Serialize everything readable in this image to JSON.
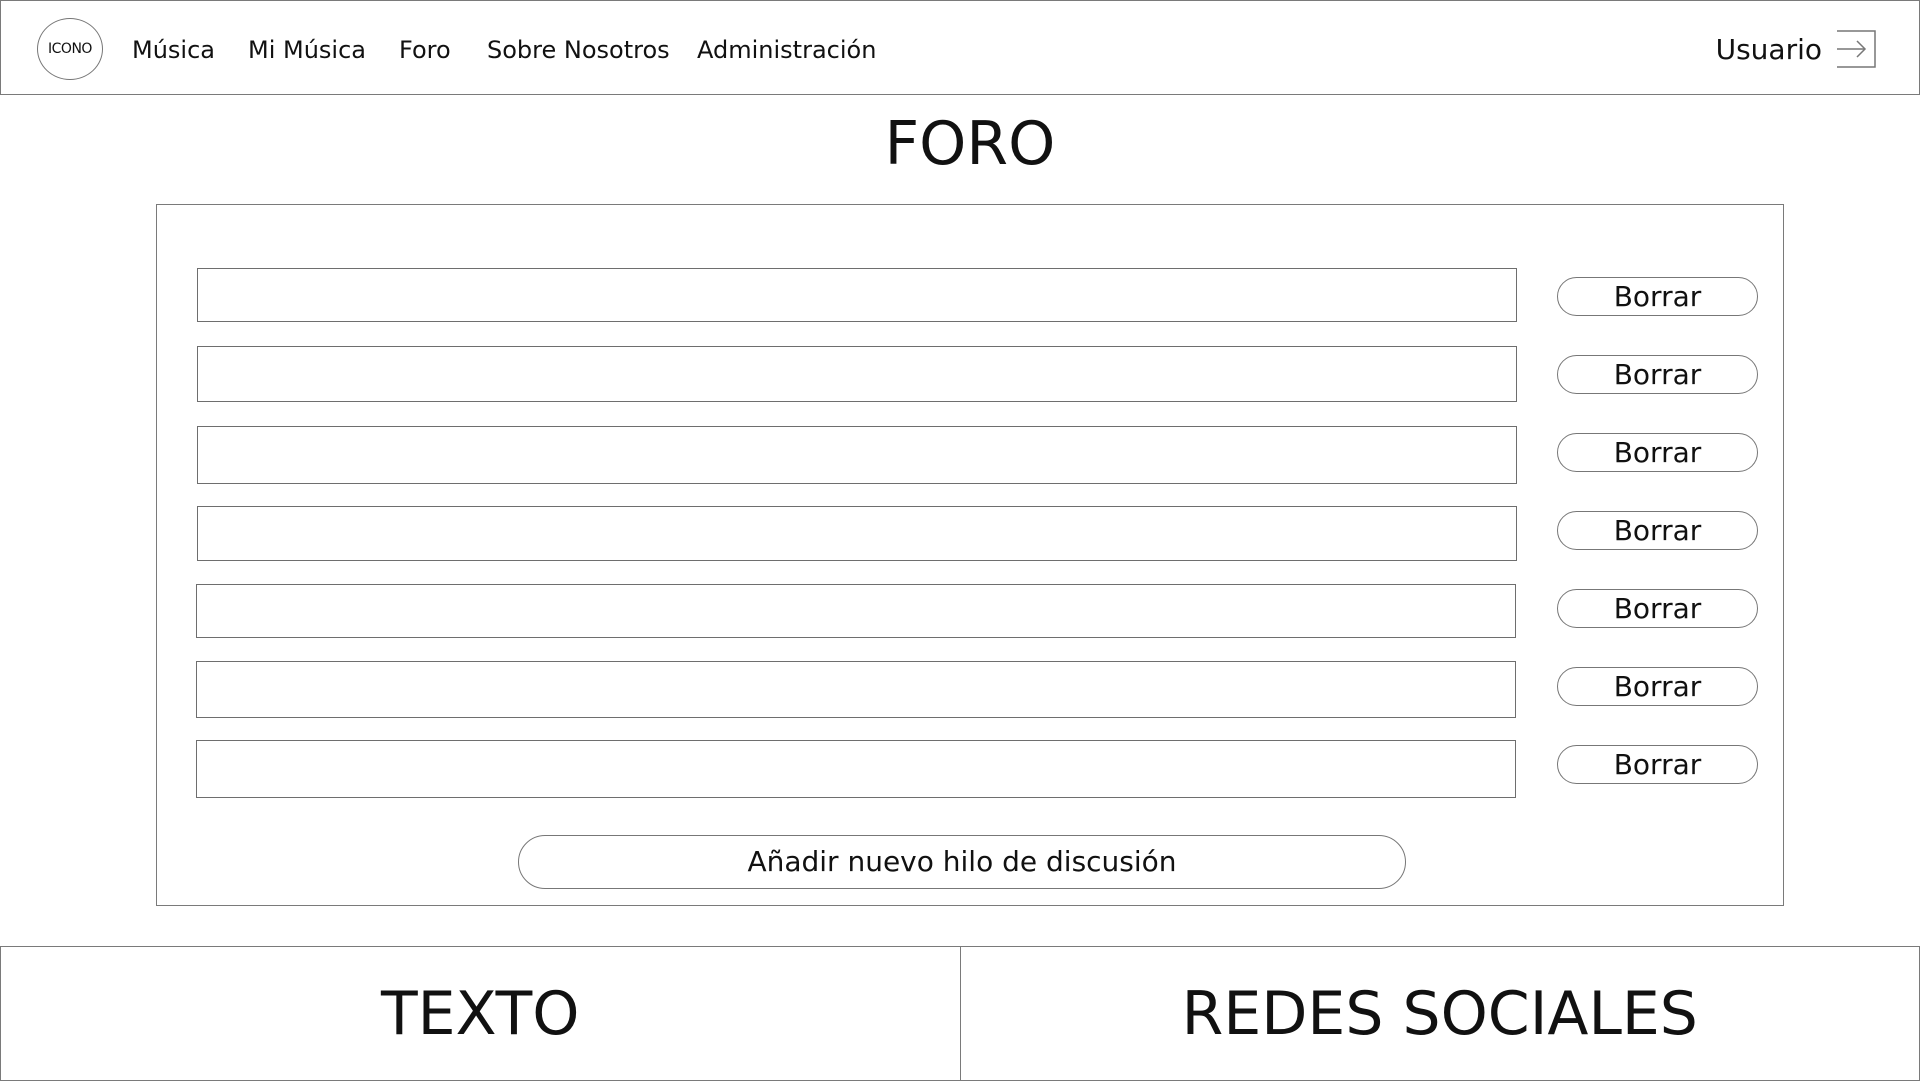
{
  "navbar": {
    "logo_text": "ICONO",
    "links": [
      "Música",
      "Mi Música",
      "Foro",
      "Sobre Nosotros",
      "Administración"
    ],
    "user_label": "Usuario",
    "logout_icon": "logout-arrow-icon"
  },
  "page_title": "FORO",
  "forum": {
    "threads": [
      {
        "value": "",
        "delete_label": "Borrar"
      },
      {
        "value": "",
        "delete_label": "Borrar"
      },
      {
        "value": "",
        "delete_label": "Borrar"
      },
      {
        "value": "",
        "delete_label": "Borrar"
      },
      {
        "value": "",
        "delete_label": "Borrar"
      },
      {
        "value": "",
        "delete_label": "Borrar"
      },
      {
        "value": "",
        "delete_label": "Borrar"
      }
    ],
    "add_thread_label": "Añadir nuevo hilo de discusión"
  },
  "footer": {
    "left_text": "TEXTO",
    "right_text": "REDES SOCIALES"
  }
}
